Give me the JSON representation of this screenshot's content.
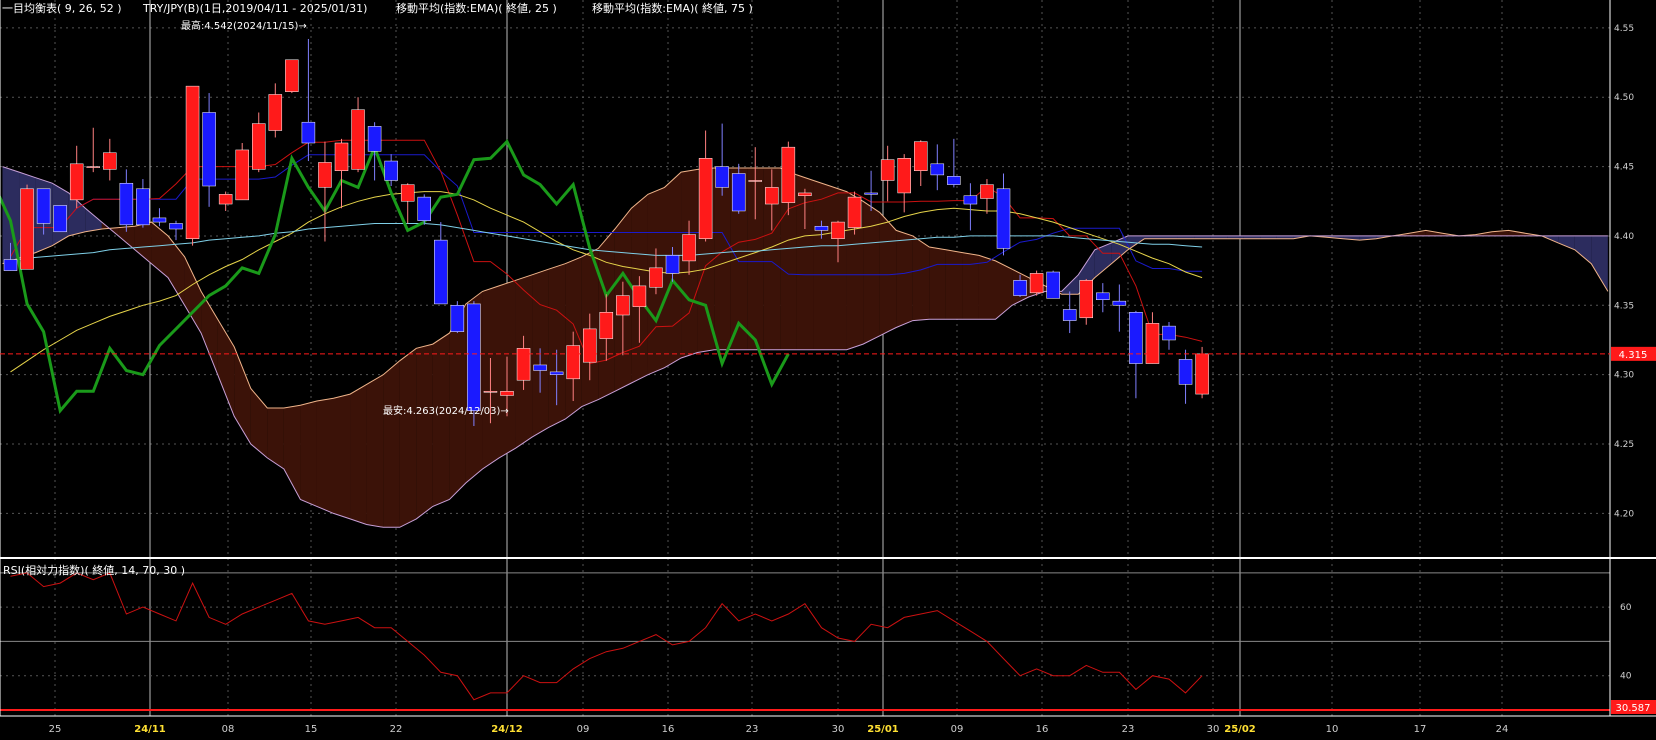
{
  "header": {
    "ichimoku": "一目均衡表( 9, 26, 52 )",
    "symbol": "TRY/JPY(B)(1日,2019/04/11 - 2025/01/31)",
    "ema25": "移動平均(指数:EMA)( 終値, 25 )",
    "ema75": "移動平均(指数:EMA)( 終値, 75 )"
  },
  "annotations": {
    "high": "最高:4.542(2024/11/15)→",
    "low": "最安:4.263(2024/12/03)→"
  },
  "price_axis": {
    "ticks": [
      "4.55",
      "4.50",
      "4.45",
      "4.40",
      "4.35",
      "4.30",
      "4.25",
      "4.20"
    ],
    "current_value": "4.315"
  },
  "rsi": {
    "title": "RSI(相対力指数)( 終値, 14, 70, 30 )",
    "ticks": [
      "60",
      "40"
    ],
    "current_value": "30.587"
  },
  "x_axis": {
    "labels": [
      {
        "text": "25",
        "month": false
      },
      {
        "text": "24/11",
        "month": true
      },
      {
        "text": "08",
        "month": false
      },
      {
        "text": "15",
        "month": false
      },
      {
        "text": "22",
        "month": false
      },
      {
        "text": "24/12",
        "month": true
      },
      {
        "text": "09",
        "month": false
      },
      {
        "text": "16",
        "month": false
      },
      {
        "text": "23",
        "month": false
      },
      {
        "text": "30",
        "month": false
      },
      {
        "text": "25/01",
        "month": true
      },
      {
        "text": "09",
        "month": false
      },
      {
        "text": "16",
        "month": false
      },
      {
        "text": "23",
        "month": false
      },
      {
        "text": "30",
        "month": false
      },
      {
        "text": "25/02",
        "month": true
      },
      {
        "text": "10",
        "month": false
      },
      {
        "text": "17",
        "month": false
      },
      {
        "text": "24",
        "month": false
      }
    ]
  },
  "colors": {
    "up": "#ff1a1a",
    "down": "#1a1aff",
    "kumo_bull": "#3b1208",
    "kumo_bear": "#2c2c5e",
    "chikou": "#1a9a1a",
    "tenkan": "#cc1111",
    "kijun": "#1a1acc",
    "ema25": "#e6d44a",
    "ema75": "#7fd0e8",
    "rsi_line": "#cc1111",
    "price_badge": "#ff1a1a"
  },
  "chart_data": {
    "type": "candlestick",
    "title": "TRY/JPY(B)(1日,2019/04/11 - 2025/01/31)",
    "ylim": [
      4.17,
      4.56
    ],
    "xlabel": "",
    "ylabel": "",
    "candles": [
      {
        "o": 4.383,
        "h": 4.395,
        "l": 4.375,
        "c": 4.375
      },
      {
        "o": 4.376,
        "h": 4.437,
        "l": 4.376,
        "c": 4.434
      },
      {
        "o": 4.434,
        "h": 4.434,
        "l": 4.401,
        "c": 4.409
      },
      {
        "o": 4.422,
        "h": 4.422,
        "l": 4.403,
        "c": 4.403
      },
      {
        "o": 4.426,
        "h": 4.465,
        "l": 4.42,
        "c": 4.452
      },
      {
        "o": 4.45,
        "h": 4.478,
        "l": 4.446,
        "c": 4.45
      },
      {
        "o": 4.448,
        "h": 4.47,
        "l": 4.44,
        "c": 4.46
      },
      {
        "o": 4.438,
        "h": 4.448,
        "l": 4.403,
        "c": 4.408
      },
      {
        "o": 4.434,
        "h": 4.441,
        "l": 4.406,
        "c": 4.408
      },
      {
        "o": 4.413,
        "h": 4.42,
        "l": 4.407,
        "c": 4.41
      },
      {
        "o": 4.409,
        "h": 4.411,
        "l": 4.397,
        "c": 4.405
      },
      {
        "o": 4.398,
        "h": 4.507,
        "l": 4.393,
        "c": 4.508
      },
      {
        "o": 4.489,
        "h": 4.503,
        "l": 4.421,
        "c": 4.436
      },
      {
        "o": 4.423,
        "h": 4.432,
        "l": 4.418,
        "c": 4.43
      },
      {
        "o": 4.426,
        "h": 4.467,
        "l": 4.426,
        "c": 4.462
      },
      {
        "o": 4.448,
        "h": 4.489,
        "l": 4.446,
        "c": 4.481
      },
      {
        "o": 4.476,
        "h": 4.51,
        "l": 4.471,
        "c": 4.502
      },
      {
        "o": 4.504,
        "h": 4.527,
        "l": 4.503,
        "c": 4.527
      },
      {
        "o": 4.482,
        "h": 4.542,
        "l": 4.454,
        "c": 4.467
      },
      {
        "o": 4.435,
        "h": 4.468,
        "l": 4.396,
        "c": 4.453
      },
      {
        "o": 4.447,
        "h": 4.47,
        "l": 4.42,
        "c": 4.467
      },
      {
        "o": 4.448,
        "h": 4.5,
        "l": 4.446,
        "c": 4.491
      },
      {
        "o": 4.479,
        "h": 4.482,
        "l": 4.44,
        "c": 4.461
      },
      {
        "o": 4.454,
        "h": 4.459,
        "l": 4.436,
        "c": 4.44
      },
      {
        "o": 4.425,
        "h": 4.438,
        "l": 4.409,
        "c": 4.437
      },
      {
        "o": 4.428,
        "h": 4.43,
        "l": 4.408,
        "c": 4.411
      },
      {
        "o": 4.397,
        "h": 4.41,
        "l": 4.351,
        "c": 4.351
      },
      {
        "o": 4.35,
        "h": 4.353,
        "l": 4.33,
        "c": 4.331
      },
      {
        "o": 4.351,
        "h": 4.353,
        "l": 4.263,
        "c": 4.274
      },
      {
        "o": 4.288,
        "h": 4.312,
        "l": 4.265,
        "c": 4.288
      },
      {
        "o": 4.285,
        "h": 4.313,
        "l": 4.27,
        "c": 4.288
      },
      {
        "o": 4.296,
        "h": 4.328,
        "l": 4.289,
        "c": 4.319
      },
      {
        "o": 4.307,
        "h": 4.319,
        "l": 4.287,
        "c": 4.303
      },
      {
        "o": 4.302,
        "h": 4.318,
        "l": 4.278,
        "c": 4.3
      },
      {
        "o": 4.297,
        "h": 4.331,
        "l": 4.281,
        "c": 4.321
      },
      {
        "o": 4.309,
        "h": 4.344,
        "l": 4.296,
        "c": 4.333
      },
      {
        "o": 4.326,
        "h": 4.358,
        "l": 4.31,
        "c": 4.345
      },
      {
        "o": 4.343,
        "h": 4.367,
        "l": 4.314,
        "c": 4.357
      },
      {
        "o": 4.349,
        "h": 4.371,
        "l": 4.323,
        "c": 4.364
      },
      {
        "o": 4.363,
        "h": 4.391,
        "l": 4.358,
        "c": 4.377
      },
      {
        "o": 4.386,
        "h": 4.392,
        "l": 4.367,
        "c": 4.373
      },
      {
        "o": 4.382,
        "h": 4.411,
        "l": 4.372,
        "c": 4.401
      },
      {
        "o": 4.398,
        "h": 4.476,
        "l": 4.396,
        "c": 4.456
      },
      {
        "o": 4.45,
        "h": 4.481,
        "l": 4.429,
        "c": 4.435
      },
      {
        "o": 4.445,
        "h": 4.452,
        "l": 4.416,
        "c": 4.418
      },
      {
        "o": 4.44,
        "h": 4.464,
        "l": 4.412,
        "c": 4.44
      },
      {
        "o": 4.423,
        "h": 4.448,
        "l": 4.404,
        "c": 4.435
      },
      {
        "o": 4.424,
        "h": 4.468,
        "l": 4.415,
        "c": 4.464
      },
      {
        "o": 4.429,
        "h": 4.434,
        "l": 4.405,
        "c": 4.431
      },
      {
        "o": 4.407,
        "h": 4.411,
        "l": 4.398,
        "c": 4.404
      },
      {
        "o": 4.398,
        "h": 4.411,
        "l": 4.381,
        "c": 4.41
      },
      {
        "o": 4.406,
        "h": 4.432,
        "l": 4.401,
        "c": 4.428
      },
      {
        "o": 4.431,
        "h": 4.447,
        "l": 4.418,
        "c": 4.43
      },
      {
        "o": 4.44,
        "h": 4.465,
        "l": 4.425,
        "c": 4.455
      },
      {
        "o": 4.431,
        "h": 4.459,
        "l": 4.417,
        "c": 4.456
      },
      {
        "o": 4.447,
        "h": 4.469,
        "l": 4.436,
        "c": 4.468
      },
      {
        "o": 4.452,
        "h": 4.466,
        "l": 4.433,
        "c": 4.444
      },
      {
        "o": 4.443,
        "h": 4.47,
        "l": 4.435,
        "c": 4.437
      },
      {
        "o": 4.429,
        "h": 4.438,
        "l": 4.404,
        "c": 4.423
      },
      {
        "o": 4.427,
        "h": 4.441,
        "l": 4.416,
        "c": 4.437
      },
      {
        "o": 4.434,
        "h": 4.445,
        "l": 4.386,
        "c": 4.391
      },
      {
        "o": 4.368,
        "h": 4.372,
        "l": 4.356,
        "c": 4.357
      },
      {
        "o": 4.359,
        "h": 4.375,
        "l": 4.357,
        "c": 4.373
      },
      {
        "o": 4.374,
        "h": 4.375,
        "l": 4.355,
        "c": 4.355
      },
      {
        "o": 4.347,
        "h": 4.36,
        "l": 4.33,
        "c": 4.339
      },
      {
        "o": 4.341,
        "h": 4.369,
        "l": 4.336,
        "c": 4.368
      },
      {
        "o": 4.359,
        "h": 4.366,
        "l": 4.345,
        "c": 4.354
      },
      {
        "o": 4.353,
        "h": 4.365,
        "l": 4.331,
        "c": 4.35
      },
      {
        "o": 4.345,
        "h": 4.346,
        "l": 4.283,
        "c": 4.308
      },
      {
        "o": 4.308,
        "h": 4.345,
        "l": 4.308,
        "c": 4.337
      },
      {
        "o": 4.335,
        "h": 4.338,
        "l": 4.318,
        "c": 4.325
      },
      {
        "o": 4.311,
        "h": 4.318,
        "l": 4.279,
        "c": 4.293
      },
      {
        "o": 4.286,
        "h": 4.32,
        "l": 4.283,
        "c": 4.315
      }
    ],
    "series": [
      {
        "name": "移動平均(指数:EMA)( 終値, 25 )",
        "values": [
          4.302,
          4.31,
          4.318,
          4.325,
          4.332,
          4.337,
          4.342,
          4.346,
          4.35,
          4.353,
          4.357,
          4.365,
          4.372,
          4.378,
          4.383,
          4.39,
          4.396,
          4.402,
          4.41,
          4.416,
          4.421,
          4.425,
          4.428,
          4.43,
          4.431,
          4.432,
          4.432,
          4.43,
          4.426,
          4.42,
          4.415,
          4.41,
          4.403,
          4.396,
          4.39,
          4.386,
          4.381,
          4.378,
          4.376,
          4.374,
          4.373,
          4.374,
          4.376,
          4.38,
          4.384,
          4.388,
          4.392,
          4.397,
          4.4,
          4.401,
          4.403,
          4.405,
          4.407,
          4.41,
          4.414,
          4.417,
          4.419,
          4.42,
          4.419,
          4.418,
          4.418,
          4.416,
          4.413,
          4.41,
          4.406,
          4.402,
          4.398,
          4.394,
          4.389,
          4.384,
          4.38,
          4.374,
          4.37
        ]
      },
      {
        "name": "移動平均(指数:EMA)( 終値, 75 )",
        "values": [
          4.382,
          4.384,
          4.385,
          4.386,
          4.387,
          4.388,
          4.39,
          4.391,
          4.392,
          4.393,
          4.394,
          4.395,
          4.397,
          4.398,
          4.399,
          4.4,
          4.402,
          4.403,
          4.405,
          4.406,
          4.407,
          4.408,
          4.409,
          4.409,
          4.409,
          4.409,
          4.408,
          4.406,
          4.404,
          4.402,
          4.4,
          4.398,
          4.396,
          4.394,
          4.392,
          4.39,
          4.389,
          4.388,
          4.387,
          4.386,
          4.386,
          4.386,
          4.387,
          4.388,
          4.389,
          4.389,
          4.39,
          4.391,
          4.392,
          4.393,
          4.393,
          4.394,
          4.395,
          4.396,
          4.397,
          4.398,
          4.399,
          4.399,
          4.4,
          4.4,
          4.4,
          4.4,
          4.4,
          4.4,
          4.399,
          4.398,
          4.397,
          4.396,
          4.395,
          4.394,
          4.394,
          4.393,
          4.392
        ]
      }
    ],
    "rsi_values": [
      69,
      70,
      66,
      67,
      70,
      68,
      70,
      58,
      60,
      58,
      56,
      67,
      57,
      55,
      58,
      60,
      62,
      64,
      56,
      55,
      56,
      57,
      54,
      54,
      50,
      46,
      41,
      40,
      33,
      35,
      35,
      40,
      38,
      38,
      42,
      45,
      47,
      48,
      50,
      52,
      49,
      50,
      54,
      61,
      56,
      58,
      56,
      58,
      61,
      54,
      51,
      50,
      55,
      54,
      57,
      58,
      59,
      56,
      53,
      50,
      45,
      40,
      42,
      40,
      40,
      43,
      41,
      41,
      36,
      40,
      39,
      35,
      40
    ],
    "rsi_ylim": [
      30,
      72
    ]
  }
}
